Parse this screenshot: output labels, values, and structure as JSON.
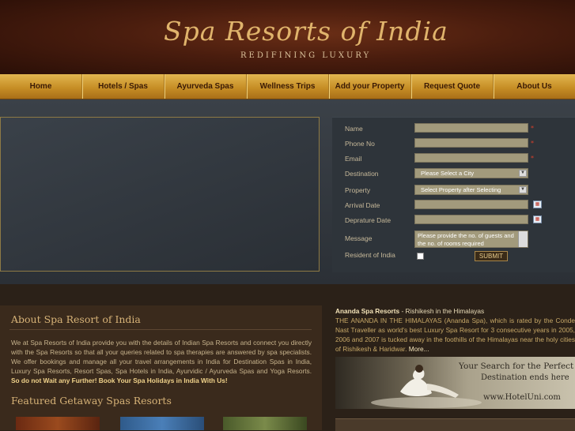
{
  "header": {
    "title": "Spa Resorts of India",
    "tagline": "REDIFINING LUXURY"
  },
  "nav": {
    "items": [
      "Home",
      "Hotels / Spas",
      "Ayurveda Spas",
      "Wellness Trips",
      "Add your Property",
      "Request Quote",
      "About Us"
    ]
  },
  "form": {
    "labels": {
      "name": "Name",
      "phone": "Phone No",
      "email": "Email",
      "destination": "Destination",
      "property": "Property",
      "arrival": "Arrival Date",
      "departure": "Depراture Date",
      "message": "Message",
      "resident": "Resident of India"
    },
    "destination_value": "Please Select a City",
    "property_value": "Select Property after Selecting",
    "message_value": "Please provide the no. of guests and the no. of rooms required",
    "submit_label": "SUBMIT",
    "required_mark": "*"
  },
  "about": {
    "title": "About Spa Resort of India",
    "text": "We at Spa Resorts of India provide you with the details of Indian Spa Resorts and connect you directly with the Spa Resorts so that all your queries related to spa therapies are answered by spa specialists. We offer bookings and manage all your travel arrangements in India for Destination Spas in India, Luxury Spa Resorts, Resort Spas, Spa Hotels in India, Ayurvidic / Ayurveda Spas and Yoga Resorts.",
    "highlight": "So do not Wait any Further!   Book Your Spa Holidays in India With Us!"
  },
  "featured": {
    "title": "Featured Getaway Spas Resorts"
  },
  "ananda": {
    "name": "Ananda Spa Resorts",
    "location": " - Rishikesh in the Himalayas",
    "text": "THE ANANDA IN THE HIMALAYAS (Ananda Spa), which is rated by the Conde Nast Traveller as world's best Luxury Spa Resort for 3 consecutive years in 2005, 2006 and 2007 is tucked away in the foothills of the Himalayas near the holy cities of Rishikesh & Haridwar.",
    "more": "More..."
  },
  "banner": {
    "line1": "Your Search for the Perfect",
    "line2": "Destination ends here",
    "line3": "www.HotelUni.com"
  },
  "colors": {
    "gold": "#d6b277",
    "nav_gold": "#c78f26",
    "required": "#d9402c"
  }
}
